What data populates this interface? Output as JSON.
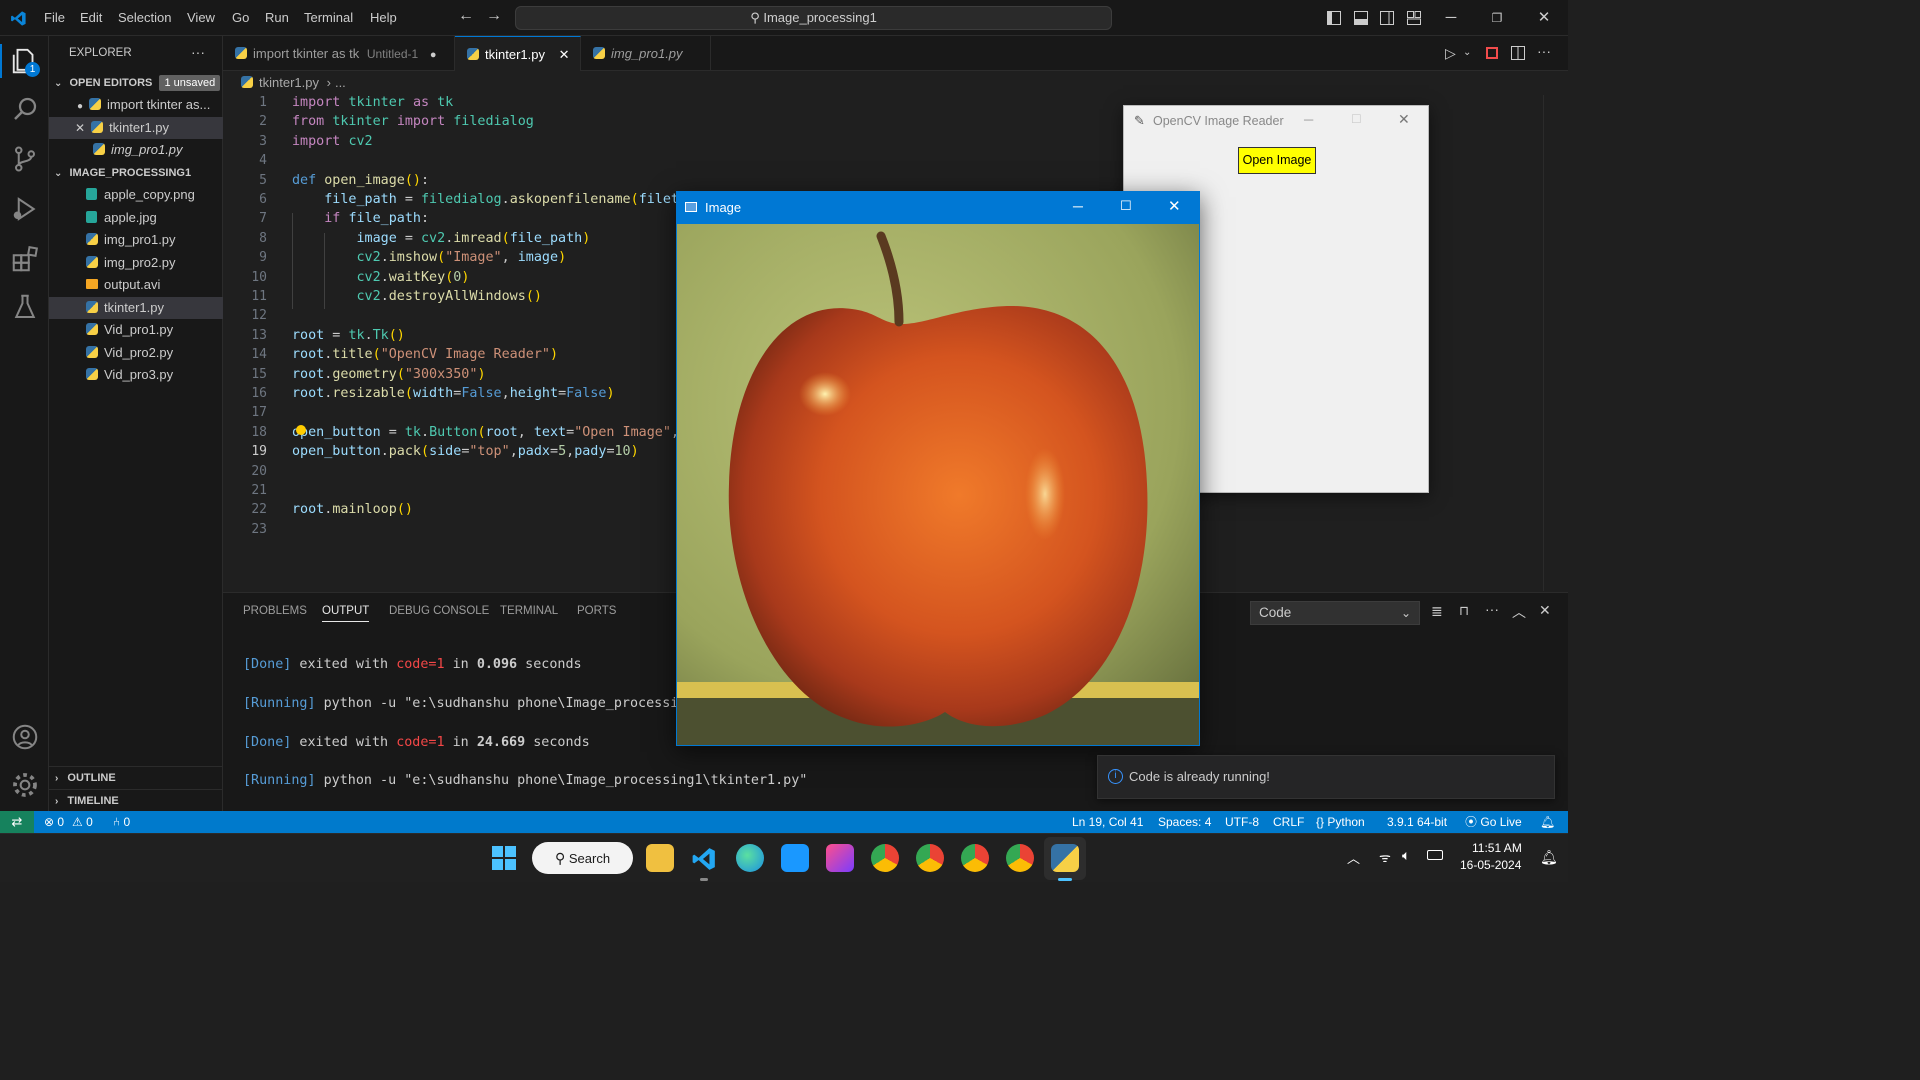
{
  "window": {
    "search_text": "Image_processing1"
  },
  "menu": [
    "File",
    "Edit",
    "Selection",
    "View",
    "Go",
    "Run",
    "Terminal",
    "Help"
  ],
  "sidebar": {
    "title": "EXPLORER",
    "more": "···",
    "open_editors_label": "OPEN EDITORS",
    "unsaved_badge": "1 unsaved",
    "open_editors": [
      {
        "label": "import tkinter as...",
        "state": "modified"
      },
      {
        "label": "tkinter1.py",
        "state": "close"
      },
      {
        "label": "img_pro1.py",
        "state": "preview"
      }
    ],
    "folder_label": "IMAGE_PROCESSING1",
    "files": [
      {
        "label": "apple_copy.png",
        "type": "png"
      },
      {
        "label": "apple.jpg",
        "type": "png"
      },
      {
        "label": "img_pro1.py",
        "type": "py"
      },
      {
        "label": "img_pro2.py",
        "type": "py"
      },
      {
        "label": "output.avi",
        "type": "avi"
      },
      {
        "label": "tkinter1.py",
        "type": "py"
      },
      {
        "label": "Vid_pro1.py",
        "type": "py"
      },
      {
        "label": "Vid_pro2.py",
        "type": "py"
      },
      {
        "label": "Vid_pro3.py",
        "type": "py"
      }
    ],
    "outline_label": "OUTLINE",
    "timeline_label": "TIMELINE"
  },
  "activity_badge": "1",
  "tabs": [
    {
      "label": "import tkinter as tk",
      "hint": "Untitled-1",
      "marker": "●"
    },
    {
      "label": "tkinter1.py",
      "marker": "✕"
    },
    {
      "label": "img_pro1.py",
      "marker": ""
    }
  ],
  "breadcrumb": {
    "file": "tkinter1.py",
    "rest": "..."
  },
  "editor": {
    "line_numbers": [
      "1",
      "2",
      "3",
      "4",
      "5",
      "6",
      "7",
      "8",
      "9",
      "10",
      "11",
      "12",
      "13",
      "14",
      "15",
      "16",
      "17",
      "18",
      "19",
      "20",
      "21",
      "22",
      "23"
    ],
    "current_line": "19"
  },
  "panel": {
    "tabs": [
      "PROBLEMS",
      "OUTPUT",
      "DEBUG CONSOLE",
      "TERMINAL",
      "PORTS"
    ],
    "active_tab": "OUTPUT",
    "channel": "Code",
    "lines": [
      {
        "a": "[Done]",
        "b": " exited with ",
        "c": "code=1",
        "d": " in ",
        "e": "0.096",
        "f": " seconds"
      },
      {
        "a": "[Running]",
        "b": " python -u \"e:\\sudhanshu phone\\Image_processin"
      },
      {
        "a": "[Done]",
        "b": " exited with ",
        "c": "code=1",
        "d": " in ",
        "e": "24.669",
        "f": " seconds"
      },
      {
        "a": "[Running]",
        "b": " python -u \"e:\\sudhanshu phone\\Image_processing1\\tkinter1.py\""
      }
    ]
  },
  "status": {
    "errors": "0",
    "warnings": "0",
    "ports": "0",
    "position": "Ln 19, Col 41",
    "spaces": "Spaces: 4",
    "encoding": "UTF-8",
    "eol": "CRLF",
    "language": "Python",
    "interpreter": "3.9.1 64-bit",
    "golive": "Go Live"
  },
  "tk_window": {
    "title": "OpenCV Image Reader",
    "button": "Open Image"
  },
  "image_window": {
    "title": "Image"
  },
  "toast": {
    "message": "Code is already running!"
  },
  "taskbar": {
    "search": "Search",
    "time": "11:51 AM",
    "date": "16-05-2024"
  }
}
